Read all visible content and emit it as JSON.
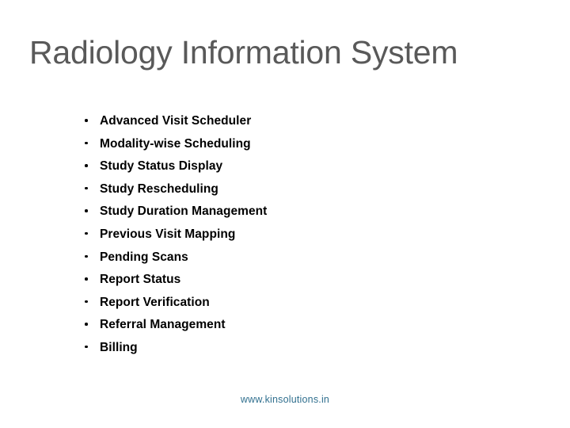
{
  "slide": {
    "title": "Radiology Information System",
    "title_color": "#595959",
    "background_color": "#ffffff",
    "bullets": [
      {
        "label": "Advanced Visit Scheduler"
      },
      {
        "label": "Modality-wise Scheduling"
      },
      {
        "label": "Study Status Display"
      },
      {
        "label": "Study Rescheduling"
      },
      {
        "label": "Study Duration Management"
      },
      {
        "label": "Previous Visit Mapping"
      },
      {
        "label": "Pending Scans"
      },
      {
        "label": "Report Status"
      },
      {
        "label": "Report Verification"
      },
      {
        "label": "Referral Management"
      },
      {
        "label": "Billing"
      }
    ],
    "footer": {
      "url": "www.kinsolutions.in",
      "color": "#31708f"
    }
  }
}
